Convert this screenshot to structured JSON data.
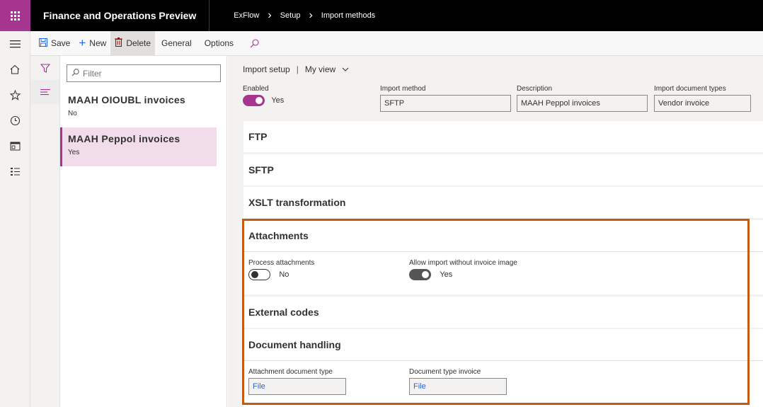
{
  "app": {
    "title": "Finance and Operations Preview",
    "breadcrumb": [
      "ExFlow",
      "Setup",
      "Import methods"
    ]
  },
  "actionbar": {
    "save": "Save",
    "new": "New",
    "delete": "Delete",
    "general": "General",
    "options": "Options"
  },
  "listpane": {
    "filter_placeholder": "Filter",
    "items": [
      {
        "title": "MAAH OIOUBL invoices",
        "sub": "No"
      },
      {
        "title": "MAAH Peppol invoices",
        "sub": "Yes"
      }
    ]
  },
  "viewbar": {
    "name": "Import setup",
    "view": "My view"
  },
  "header": {
    "enabled_label": "Enabled",
    "enabled_value": "Yes",
    "import_method_label": "Import method",
    "import_method_value": "SFTP",
    "description_label": "Description",
    "description_value": "MAAH Peppol invoices",
    "doc_types_label": "Import document types",
    "doc_types_value": "Vendor invoice"
  },
  "sections": {
    "ftp": "FTP",
    "sftp": "SFTP",
    "xslt": "XSLT transformation",
    "attachments": {
      "title": "Attachments",
      "process_label": "Process attachments",
      "process_value": "No",
      "allow_label": "Allow import without invoice image",
      "allow_value": "Yes"
    },
    "external_codes": "External codes",
    "document_handling": {
      "title": "Document handling",
      "attach_type_label": "Attachment document type",
      "attach_type_value": "File",
      "invoice_type_label": "Document type invoice",
      "invoice_type_value": "File"
    }
  },
  "colors": {
    "brand": "#a5358f",
    "highlight": "#c55a11"
  }
}
